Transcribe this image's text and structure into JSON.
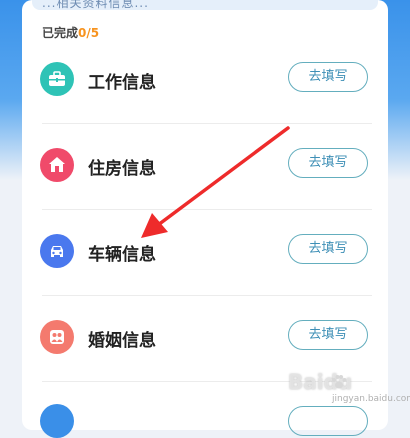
{
  "notice": {
    "text": "...相关资料信息..."
  },
  "progress": {
    "prefix": "已完成",
    "count": "0/5"
  },
  "rows": [
    {
      "label": "工作信息",
      "button": "去填写",
      "icon": "briefcase-icon",
      "color": "#2ec3b6"
    },
    {
      "label": "住房信息",
      "button": "去填写",
      "icon": "house-icon",
      "color": "#f04a6a"
    },
    {
      "label": "车辆信息",
      "button": "去填写",
      "icon": "car-icon",
      "color": "#4a78ee"
    },
    {
      "label": "婚姻信息",
      "button": "去填写",
      "icon": "couple-icon",
      "color": "#f47a6e"
    }
  ],
  "watermark": {
    "main": "Baidu",
    "sub": "jingyan.baidu.com"
  }
}
